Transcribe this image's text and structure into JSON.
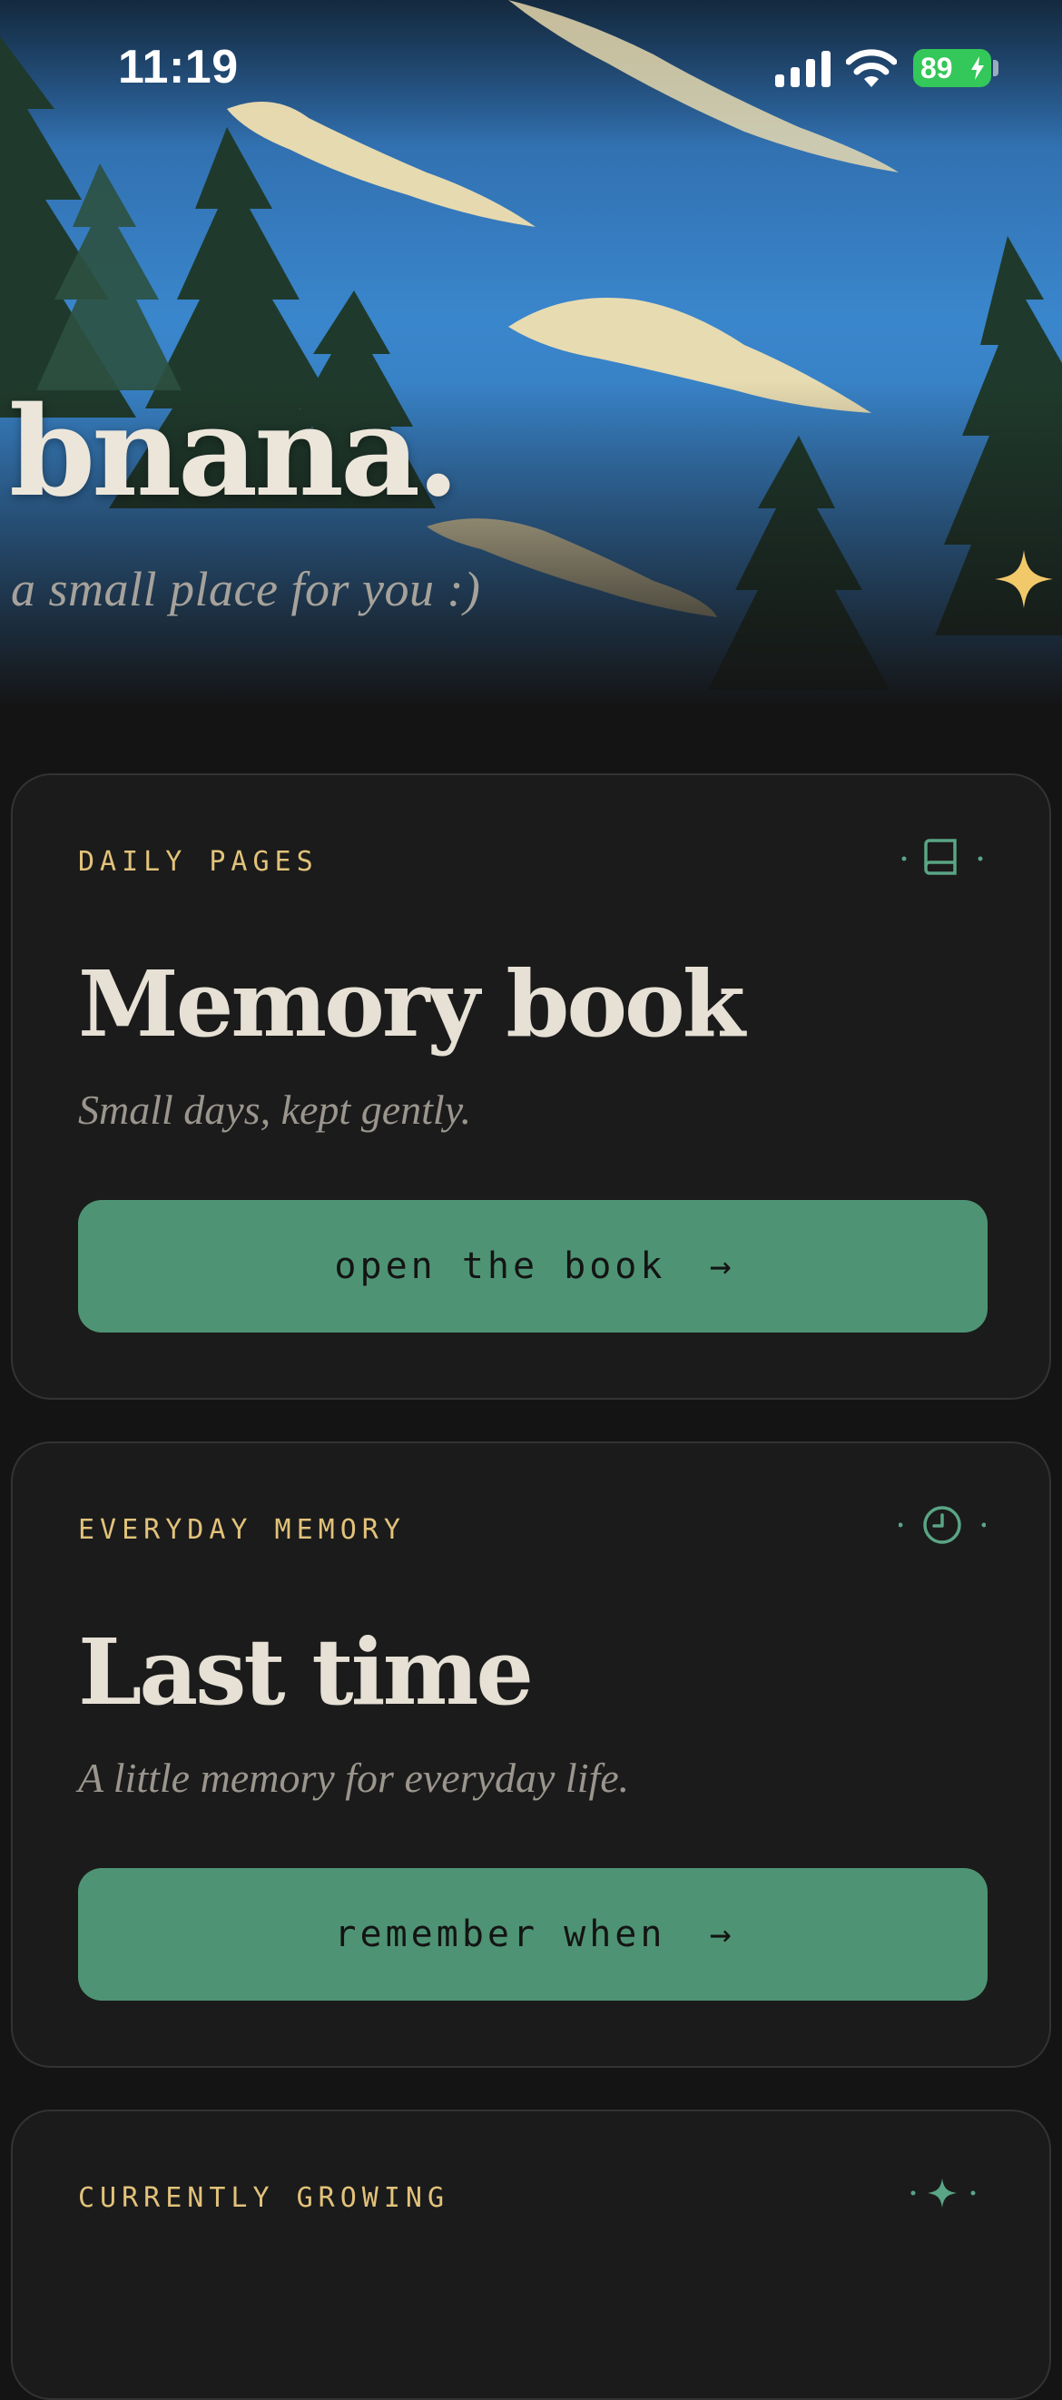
{
  "status_bar": {
    "time": "11:19",
    "battery_level": "89",
    "battery_charging": true,
    "icons": [
      "signal-icon",
      "wifi-icon",
      "battery-icon"
    ]
  },
  "hero": {
    "title": "bnana.",
    "subtitle": "a small place for you :)",
    "decoration_icon": "sparkle-icon"
  },
  "cards": [
    {
      "eyebrow": "DAILY PAGES",
      "icon": "book-icon",
      "title": "Memory book",
      "subtitle": "Small days, kept gently.",
      "button_label": "open the book",
      "button_arrow": "→"
    },
    {
      "eyebrow": "EVERYDAY MEMORY",
      "icon": "clock-icon",
      "title": "Last time",
      "subtitle": "A little memory for everyday life.",
      "button_label": "remember when",
      "button_arrow": "→"
    },
    {
      "eyebrow": "CURRENTLY GROWING",
      "icon": "sparkle-icon"
    }
  ],
  "colors": {
    "background": "#141414",
    "card_background": "#1b1b1b",
    "accent_green": "#4e9474",
    "eyebrow_gold": "#e2c27a",
    "title_cream": "#e6e0d5",
    "icon_green": "#5aa585",
    "sky_blue": "#3b82c4",
    "battery_green": "#34c759"
  }
}
